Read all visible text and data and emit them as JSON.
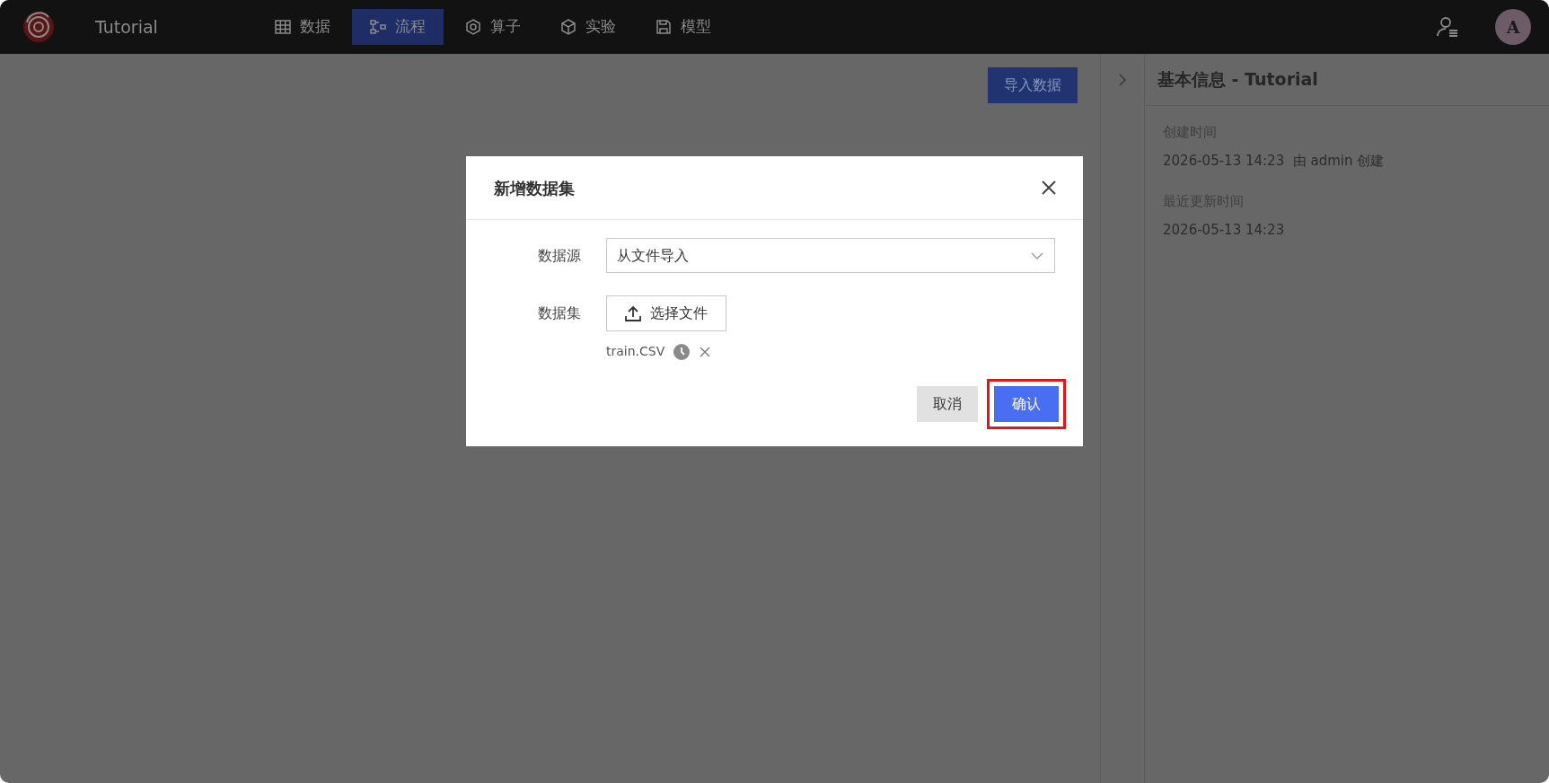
{
  "app": {
    "title": "Tutorial"
  },
  "nav_tabs": [
    {
      "label": "数据",
      "selected": false
    },
    {
      "label": "流程",
      "selected": true
    },
    {
      "label": "算子",
      "selected": false
    },
    {
      "label": "实验",
      "selected": false
    },
    {
      "label": "模型",
      "selected": false
    }
  ],
  "user": {
    "avatar_letter": "A"
  },
  "toolbar": {
    "import_button": "导入数据"
  },
  "info_panel": {
    "title": "基本信息 - Tutorial",
    "fields": [
      {
        "label": "创建时间",
        "value": "2026-05-13 14:23  由 admin 创建"
      },
      {
        "label": "最近更新时间",
        "value": "2026-05-13 14:23"
      }
    ]
  },
  "dialog": {
    "title": "新增数据集",
    "source": {
      "label": "数据源",
      "value": "从文件导入"
    },
    "dataset": {
      "label": "数据集",
      "upload_button": "选择文件",
      "file": {
        "name": "train.CSV"
      }
    },
    "buttons": [
      {
        "label": "取消",
        "kind": "secondary",
        "highlighted": false
      },
      {
        "label": "确认",
        "kind": "primary",
        "highlighted": true
      }
    ]
  }
}
